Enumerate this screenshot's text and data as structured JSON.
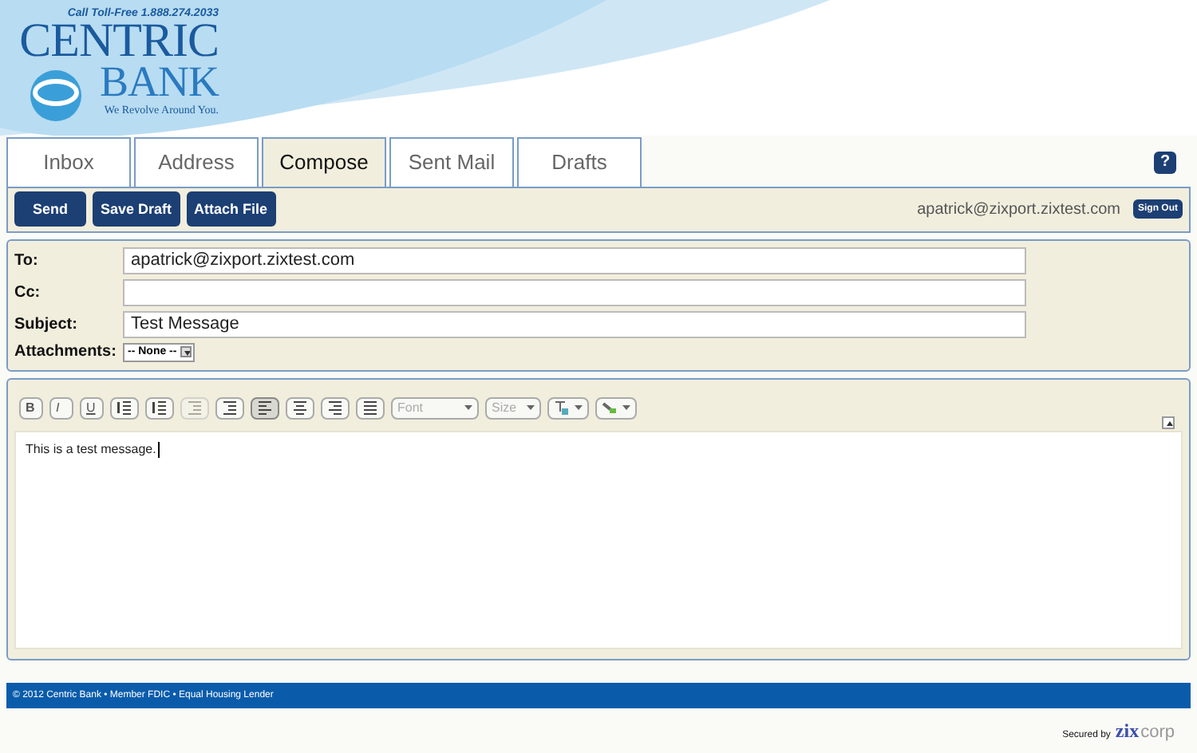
{
  "header": {
    "phone": "Call Toll-Free 1.888.274.2033",
    "bank_name": [
      "CENTRIC",
      "BANK"
    ],
    "tagline": "We Revolve Around You."
  },
  "tabs": [
    {
      "label": "Inbox",
      "selected": false
    },
    {
      "label": "Address",
      "selected": false
    },
    {
      "label": "Compose",
      "selected": true
    },
    {
      "label": "Sent Mail",
      "selected": false
    },
    {
      "label": "Drafts",
      "selected": false
    }
  ],
  "help": "?",
  "actions": [
    "Send",
    "Save Draft",
    "Attach File"
  ],
  "user": {
    "email": "apatrick@zixport.zixtest.com",
    "sign_out": "Sign Out"
  },
  "fields": [
    {
      "label": "To:",
      "kind": "text",
      "value": "apatrick@zixport.zixtest.com"
    },
    {
      "label": "Cc:",
      "kind": "text"
    },
    {
      "label": "Subject:",
      "kind": "text",
      "value": "Test Message"
    },
    {
      "label": "Attachments:",
      "kind": "select",
      "value": "-- None --"
    }
  ],
  "editor": {
    "tools": [
      {
        "kind": "bold",
        "label": "B",
        "selected": false,
        "disabled": false
      },
      {
        "kind": "italic",
        "label": "I",
        "selected": false,
        "disabled": false
      },
      {
        "kind": "underline",
        "label": "U",
        "selected": false,
        "disabled": false
      },
      {
        "kind": "ordered-list",
        "selected": false,
        "disabled": false
      },
      {
        "kind": "bullet-list",
        "selected": false,
        "disabled": false
      },
      {
        "kind": "outdent",
        "selected": false,
        "disabled": true
      },
      {
        "kind": "indent",
        "selected": false,
        "disabled": false
      },
      {
        "kind": "align-left",
        "selected": true,
        "disabled": false
      },
      {
        "kind": "align-center",
        "selected": false,
        "disabled": false
      },
      {
        "kind": "align-right",
        "selected": false,
        "disabled": false
      },
      {
        "kind": "justify",
        "selected": false,
        "disabled": false
      },
      {
        "kind": "dropdown",
        "label": "Font",
        "selected": false,
        "disabled": false
      },
      {
        "kind": "dropdown",
        "label": "Size",
        "selected": false,
        "disabled": false
      },
      {
        "kind": "text-color",
        "selected": false,
        "disabled": false
      },
      {
        "kind": "highlight-color",
        "selected": false,
        "disabled": false
      }
    ],
    "body": "This is a test message."
  },
  "footer": "© 2012 Centric Bank • Member FDIC • Equal Housing Lender",
  "secured": {
    "label": "Secured by",
    "logo": [
      "zix",
      "corp"
    ]
  }
}
